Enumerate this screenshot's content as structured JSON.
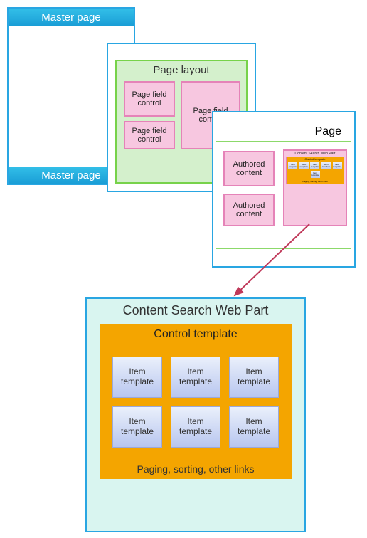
{
  "master": {
    "top_label": "Master page",
    "bottom_label": "Master page"
  },
  "layout": {
    "title": "Page layout",
    "field1": "Page field control",
    "field2": "Page field control",
    "field3": "Page field control"
  },
  "page": {
    "title": "Page",
    "authored1": "Authored content",
    "authored2": "Authored content",
    "mini_cswp_title": "Content Search Web Part",
    "mini_control_title": "Control template",
    "mini_item": "Item template",
    "mini_footer": "Paging, sorting, other links"
  },
  "cswp": {
    "title": "Content Search Web Part",
    "control_title": "Control template",
    "item_label": "Item template",
    "footer": "Paging, sorting, other links"
  }
}
